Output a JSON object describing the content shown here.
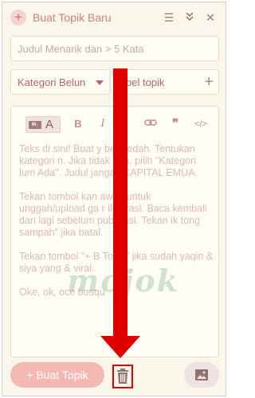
{
  "header": {
    "title": "Buat Topik Baru",
    "new_icon": "plus-circle-icon",
    "menu_icon": "hamburger-icon",
    "collapse_icon": "double-chevron-down-icon",
    "close_icon": "close-icon"
  },
  "form": {
    "title_placeholder": "Judul Menarik dan > 5 Kata",
    "category_label": "Kategori Belun",
    "tag_label": "bel topik",
    "tag_add_icon": "plus-icon"
  },
  "toolbar": {
    "md_badge": "M↓",
    "format_label": "A",
    "bold": "B",
    "italic": "I",
    "quote": "❞",
    "code": "</>"
  },
  "editor": {
    "paragraph_1": "Teks di sini! Buat y        berfaedah. Tentukan kategori        n. Jika tidak ada, pilih \"Kategori        lum Ada\". Judul jangan KAPITAL        EMUA.",
    "paragraph_2": "Tekan tombol kan        awah untuk unggah/upload ga        r ilustrasi. Baca kembali dan        lagi sebelum publikasi. Tekan ik        tong sampah\" jika batal.",
    "paragraph_3": "Tekan tombol \"+ B        Topik\" jika sudah yaqin & siya        yang & viral.",
    "paragraph_4": "Oke, ok, oce bosqu",
    "watermark": "mojok"
  },
  "footer": {
    "submit_label": "Buat Topik",
    "submit_icon": "plus-icon",
    "trash_icon": "trash-icon",
    "image_icon": "image-icon"
  },
  "colors": {
    "accent": "#f4b8b4",
    "arrow": "#e00000",
    "panel": "#fbf6ea"
  }
}
